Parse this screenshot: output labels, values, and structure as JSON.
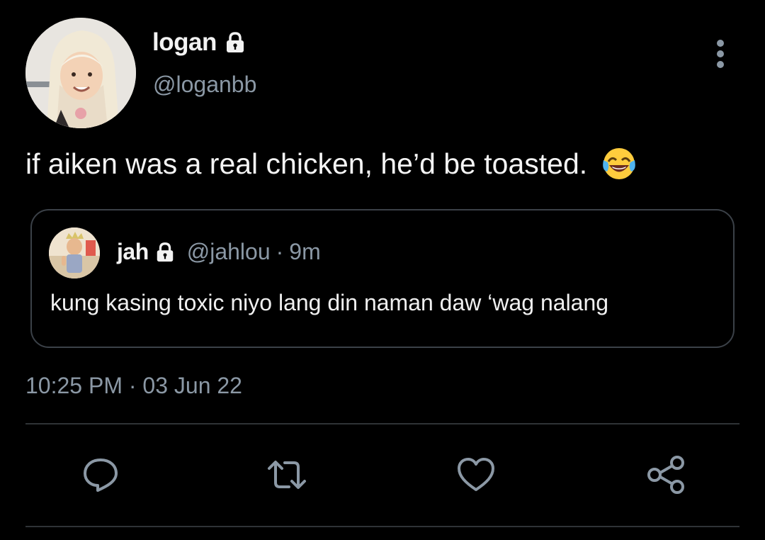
{
  "author": {
    "display_name": "logan",
    "handle": "@loganbb",
    "protected_icon": "lock-icon",
    "avatar_icon": "profile-photo"
  },
  "tweet": {
    "text": "if aiken was a real chicken, he’d be toasted.",
    "emoji_icon": "face-with-tears-of-joy-emoji",
    "time": "10:25 PM",
    "separator": "·",
    "date": "03 Jun 22"
  },
  "quoted_tweet": {
    "display_name": "jah",
    "handle": "@jahlou",
    "separator": "·",
    "age": "9m",
    "text": "kung kasing toxic niyo lang din naman daw ‘wag nalang",
    "protected_icon": "lock-icon"
  },
  "actions": [
    {
      "name": "reply",
      "icon": "speech-bubble-icon"
    },
    {
      "name": "retweet",
      "icon": "retweet-icon"
    },
    {
      "name": "like",
      "icon": "heart-icon"
    },
    {
      "name": "share",
      "icon": "share-nodes-icon"
    }
  ],
  "menu": {
    "icon": "vertical-ellipsis-icon"
  },
  "colors": {
    "background": "#000000",
    "primary_text": "#e7e9ea",
    "secondary_text": "#8b98a5",
    "border": "#3b4148",
    "divider": "#2f3336"
  }
}
